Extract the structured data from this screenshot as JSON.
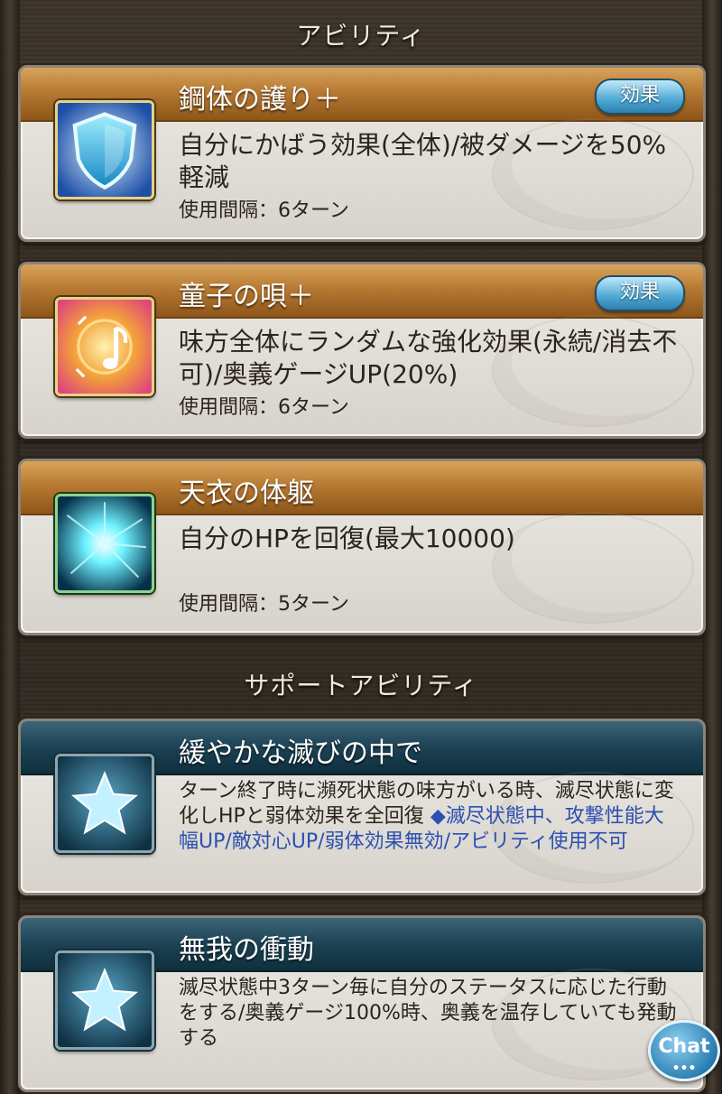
{
  "ability_section": {
    "header": "アビリティ",
    "abilities": [
      {
        "name": "鋼体の護り＋",
        "has_effect_button": true,
        "description": "自分にかばう効果(全体)/被ダメージを50%軽減",
        "cooldown": "使用間隔：6ターン",
        "icon": "shield-icon"
      },
      {
        "name": "童子の唄＋",
        "has_effect_button": true,
        "description": "味方全体にランダムな強化効果(永続/消去不可)/奥義ゲージUP(20%)",
        "cooldown": "使用間隔：6ターン",
        "icon": "music-note-icon"
      },
      {
        "name": "天衣の体躯",
        "has_effect_button": false,
        "description": "自分のHPを回復(最大10000)",
        "cooldown": "使用間隔：5ターン",
        "icon": "heal-burst-icon"
      }
    ],
    "effect_button_label": "効果"
  },
  "support_section": {
    "header": "サポートアビリティ",
    "abilities": [
      {
        "name": "緩やかな滅びの中で",
        "description": "ターン終了時に瀕死状態の味方がいる時、滅尽状態に変化しHPと弱体効果を全回復",
        "effect_note": "◆滅尽状態中、攻撃性能大幅UP/敵対心UP/弱体効果無効/アビリティ使用不可",
        "icon": "star-icon"
      },
      {
        "name": "無我の衝動",
        "description": "滅尽状態中3ターン毎に自分のステータスに応じた行動をする/奥義ゲージ100%時、奥義を温存していても発動する",
        "effect_note": "",
        "icon": "star-icon"
      }
    ]
  },
  "chat": {
    "label": "Chat",
    "dots": "•••"
  },
  "colors": {
    "gold_bar": "#b87a33",
    "teal_bar": "#1c4254",
    "effect_blue": "#2c4fb0",
    "effect_button": "#4fa8d3"
  }
}
